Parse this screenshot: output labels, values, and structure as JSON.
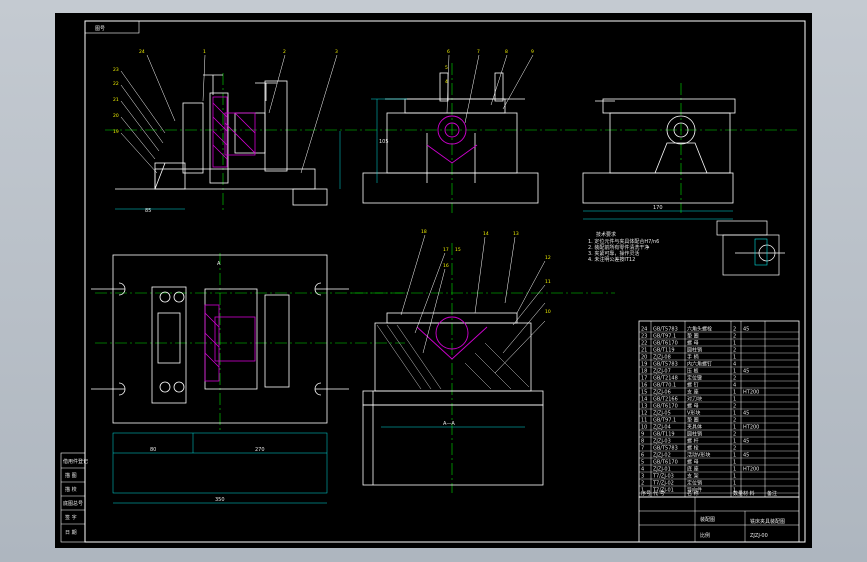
{
  "title_block": {
    "top_left_tag": "图号",
    "drawing_title": "铣床夹具装配图",
    "drawing_no": "ZJZJ-00",
    "school": "装配图",
    "scale_label": "比例",
    "left_strip": [
      "借用件登记",
      "描 图",
      "描 校",
      "底图总号",
      "签 字",
      "日 期"
    ]
  },
  "technical_requirements": {
    "title": "技术要求",
    "items": [
      "1. 定位元件与夹具体配合H7/n6",
      "2. 装配前所有零件清洗干净",
      "3. 夹紧可靠，操作灵活",
      "4. 未注明公差按IT12"
    ]
  },
  "part_labels": {
    "front_view": [
      "24",
      "1",
      "2",
      "3",
      "23",
      "22",
      "21",
      "20",
      "19"
    ],
    "side_view": [
      "6",
      "7",
      "8",
      "9",
      "5",
      "4"
    ],
    "section_view": [
      "18",
      "17",
      "16",
      "15",
      "14",
      "13",
      "12",
      "11",
      "10"
    ],
    "plan_view": [
      "A"
    ]
  },
  "dimensions": {
    "front_view_bottom": "85",
    "side_view_height": "105",
    "right_view_bottom": "170",
    "plan_width_left": "80",
    "plan_width_right": "270",
    "plan_total": "350",
    "section_bottom": "A—A"
  },
  "bom": {
    "header": [
      "序号",
      "代 号",
      "名 称",
      "数量",
      "材 料",
      "备注"
    ],
    "rows": [
      [
        "24",
        "GB/T5783",
        "六角头螺栓",
        "2",
        "45",
        ""
      ],
      [
        "23",
        "GB/T97.1",
        "垫 圈",
        "2",
        "",
        ""
      ],
      [
        "22",
        "GB/T6170",
        "螺 母",
        "1",
        "",
        ""
      ],
      [
        "21",
        "GB/T119",
        "圆柱销",
        "2",
        "",
        ""
      ],
      [
        "20",
        "ZJZJ-08",
        "手 柄",
        "1",
        "",
        ""
      ],
      [
        "19",
        "GB/T5783",
        "内六角螺钉",
        "4",
        "",
        ""
      ],
      [
        "18",
        "ZJZJ-07",
        "压 板",
        "1",
        "45",
        ""
      ],
      [
        "17",
        "GB/T2148",
        "定位键",
        "2",
        "",
        ""
      ],
      [
        "16",
        "GB/T70.1",
        "螺 钉",
        "4",
        "",
        ""
      ],
      [
        "15",
        "ZJZJ-06",
        "支 座",
        "1",
        "HT200",
        ""
      ],
      [
        "14",
        "GB/T2166",
        "对刀块",
        "1",
        "",
        ""
      ],
      [
        "13",
        "GB/T6170",
        "螺 母",
        "2",
        "",
        ""
      ],
      [
        "12",
        "ZJZJ-05",
        "V形块",
        "1",
        "45",
        ""
      ],
      [
        "11",
        "GB/T97.1",
        "垫 圈",
        "2",
        "",
        ""
      ],
      [
        "10",
        "ZJZJ-04",
        "夹具体",
        "1",
        "HT200",
        ""
      ],
      [
        "9",
        "GB/T119",
        "圆柱销",
        "2",
        "",
        ""
      ],
      [
        "8",
        "ZJZJ-03",
        "螺 杆",
        "1",
        "45",
        ""
      ],
      [
        "7",
        "GB/T5783",
        "螺 栓",
        "2",
        "",
        ""
      ],
      [
        "6",
        "ZJZJ-02",
        "活动V形块",
        "1",
        "45",
        ""
      ],
      [
        "5",
        "GB/T6170",
        "螺 母",
        "1",
        "",
        ""
      ],
      [
        "4",
        "ZJZJ-01",
        "底 座",
        "1",
        "HT200",
        ""
      ],
      [
        "3",
        "T7/ZJ-03",
        "支 架",
        "1",
        "",
        ""
      ],
      [
        "2",
        "T7/ZJ-02",
        "定位销",
        "1",
        "",
        ""
      ],
      [
        "1",
        "T7/ZJ-01",
        "导向件",
        "1",
        "",
        ""
      ]
    ]
  },
  "colors": {
    "sheet_bg": "#000000",
    "lines": "#ffffff",
    "centerline": "#00e000",
    "dimension": "#00e0e0",
    "hatch": "#d000d0",
    "text_yellow": "#f0f000"
  }
}
